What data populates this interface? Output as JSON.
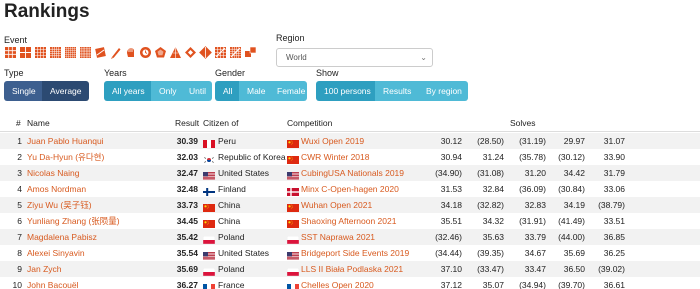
{
  "title": "Rankings",
  "filters": {
    "event_label": "Event",
    "region_label": "Region",
    "region_value": "World",
    "type_label": "Type",
    "type_options": [
      "Single",
      "Average"
    ],
    "type_selected": "Average",
    "years_label": "Years",
    "years_options": [
      "All years",
      "Only",
      "Until"
    ],
    "years_selected": "All years",
    "gender_label": "Gender",
    "gender_options": [
      "All",
      "Male",
      "Female"
    ],
    "gender_selected": "All",
    "show_label": "Show",
    "show_options": [
      "100 persons",
      "Results",
      "By region"
    ],
    "show_selected": "100 persons"
  },
  "events": [
    "333",
    "222",
    "444",
    "555",
    "666",
    "777",
    "333bf",
    "333fm",
    "333oh",
    "clock",
    "minx",
    "pyram",
    "skewb",
    "sq1",
    "444bf",
    "555bf",
    "333mbf"
  ],
  "table": {
    "headers": {
      "rank": "#",
      "name": "Name",
      "result": "Result",
      "citizen": "Citizen of",
      "competition": "Competition",
      "solves": "Solves"
    },
    "rows": [
      {
        "rank": "1",
        "name": "Juan Pablo Huanqui",
        "result": "30.39",
        "country": "Peru",
        "country_flag": "pe",
        "competition": "Wuxi Open 2019",
        "comp_flag": "cn",
        "solves": [
          "30.12",
          "(28.50)",
          "(31.19)",
          "29.97",
          "31.07"
        ]
      },
      {
        "rank": "2",
        "name": "Yu Da-Hyun (유다현)",
        "result": "32.03",
        "country": "Republic of Korea",
        "country_flag": "kr",
        "competition": "CWR Winter 2018",
        "comp_flag": "cn",
        "solves": [
          "30.94",
          "31.24",
          "(35.78)",
          "(30.12)",
          "33.90"
        ]
      },
      {
        "rank": "3",
        "name": "Nicolas Naing",
        "result": "32.47",
        "country": "United States",
        "country_flag": "us",
        "competition": "CubingUSA Nationals 2019",
        "comp_flag": "us",
        "solves": [
          "(34.90)",
          "(31.08)",
          "31.20",
          "34.42",
          "31.79"
        ]
      },
      {
        "rank": "4",
        "name": "Amos Nordman",
        "result": "32.48",
        "country": "Finland",
        "country_flag": "fi",
        "competition": "Minx C-Open-hagen 2020",
        "comp_flag": "dk",
        "solves": [
          "31.53",
          "32.84",
          "(36.09)",
          "(30.84)",
          "33.06"
        ]
      },
      {
        "rank": "5",
        "name": "Ziyu Wu (吴子钰)",
        "result": "33.73",
        "country": "China",
        "country_flag": "cn",
        "competition": "Wuhan Open 2021",
        "comp_flag": "cn",
        "solves": [
          "34.18",
          "(32.82)",
          "32.83",
          "34.19",
          "(38.79)"
        ]
      },
      {
        "rank": "6",
        "name": "Yunliang Zhang (张陨量)",
        "result": "34.45",
        "country": "China",
        "country_flag": "cn",
        "competition": "Shaoxing Afternoon 2021",
        "comp_flag": "cn",
        "solves": [
          "35.51",
          "34.32",
          "(31.91)",
          "(41.49)",
          "33.51"
        ]
      },
      {
        "rank": "7",
        "name": "Magdalena Pabisz",
        "result": "35.42",
        "country": "Poland",
        "country_flag": "pl",
        "competition": "SST Naprawa 2021",
        "comp_flag": "pl",
        "solves": [
          "(32.46)",
          "35.63",
          "33.79",
          "(44.00)",
          "36.85"
        ]
      },
      {
        "rank": "8",
        "name": "Alexei Sinyavin",
        "result": "35.54",
        "country": "United States",
        "country_flag": "us",
        "competition": "Bridgeport Side Events 2019",
        "comp_flag": "us",
        "solves": [
          "(34.44)",
          "(39.35)",
          "34.67",
          "35.69",
          "36.25"
        ]
      },
      {
        "rank": "9",
        "name": "Jan Zych",
        "result": "35.69",
        "country": "Poland",
        "country_flag": "pl",
        "competition": "LLS II Biała Podlaska 2021",
        "comp_flag": "pl",
        "solves": [
          "37.10",
          "(33.47)",
          "33.47",
          "36.50",
          "(39.02)"
        ]
      },
      {
        "rank": "10",
        "name": "John Bacouël",
        "result": "36.27",
        "country": "France",
        "country_flag": "fr",
        "competition": "Chelles Open 2020",
        "comp_flag": "fr",
        "solves": [
          "37.12",
          "35.07",
          "(34.94)",
          "(39.70)",
          "36.61"
        ]
      }
    ]
  },
  "colors": {
    "accent": "#d85a1f",
    "dark_button": "#3d5f8f",
    "cyan_button": "#4fbad6",
    "icon": "#e0521f"
  }
}
